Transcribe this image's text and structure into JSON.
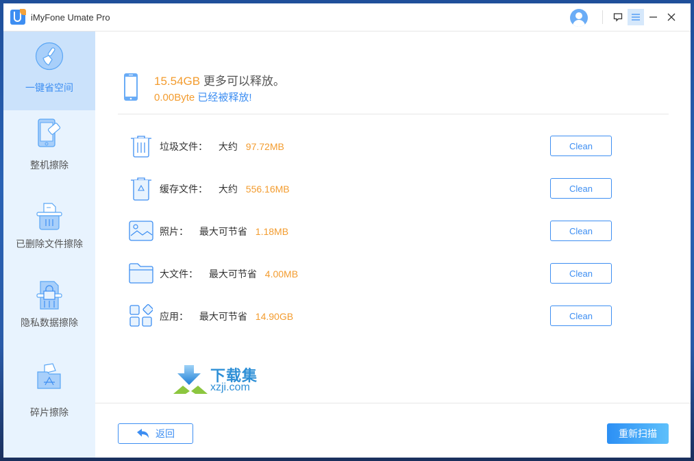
{
  "app": {
    "title": "iMyFone Umate Pro"
  },
  "titlebar": {
    "icons": [
      "account-icon",
      "feedback-icon",
      "menu-icon",
      "minimize-icon",
      "close-icon"
    ]
  },
  "sidebar": {
    "items": [
      {
        "label": "一键省空间",
        "icon": "broom-icon",
        "active": true
      },
      {
        "label": "整机擦除",
        "icon": "phone-eraser-icon",
        "active": false
      },
      {
        "label": "已删除文件擦除",
        "icon": "deleted-file-shredder-icon",
        "active": false
      },
      {
        "label": "隐私数据擦除",
        "icon": "private-data-shredder-icon",
        "active": false
      },
      {
        "label": "碎片擦除",
        "icon": "fragment-folder-icon",
        "active": false
      }
    ]
  },
  "summary": {
    "freeable_amount": "15.54GB",
    "freeable_text": "更多可以释放。",
    "freed_amount": "0.00Byte",
    "freed_text": "已经被释放!"
  },
  "categories": [
    {
      "name": "垃圾文件：",
      "qualifier": "大约",
      "size": "97.72MB",
      "icon": "trash-icon",
      "button": "Clean"
    },
    {
      "name": "缓存文件：",
      "qualifier": "大约",
      "size": "556.16MB",
      "icon": "recycle-bin-icon",
      "button": "Clean"
    },
    {
      "name": "照片：",
      "qualifier": "最大可节省",
      "size": "1.18MB",
      "icon": "photo-icon",
      "button": "Clean"
    },
    {
      "name": "大文件：",
      "qualifier": "最大可节省",
      "size": "4.00MB",
      "icon": "folder-icon",
      "button": "Clean"
    },
    {
      "name": "应用：",
      "qualifier": "最大可节省",
      "size": "14.90GB",
      "icon": "apps-icon",
      "button": "Clean"
    }
  ],
  "watermark": {
    "title": "下载集",
    "domain": "xzji.com"
  },
  "footer": {
    "back_label": "返回",
    "rescan_label": "重新扫描"
  },
  "colors": {
    "accent": "#3d8ef2",
    "highlight": "#f39c2f",
    "sidebar_bg": "#e8f3fe",
    "sidebar_active": "#cbe2fb"
  }
}
